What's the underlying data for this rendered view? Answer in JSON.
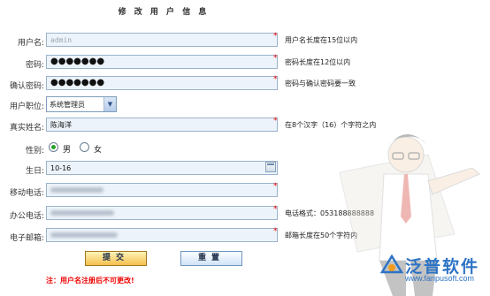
{
  "title": "修 改 用 户 信 息",
  "fields": {
    "username": {
      "label": "用户名:",
      "value": "admin",
      "hint": "用户名长度在15位以内"
    },
    "password": {
      "label": "密码:",
      "value": "●●●●●●●",
      "hint": "密码长度在12位以内"
    },
    "confirm": {
      "label": "确认密码:",
      "value": "●●●●●●●",
      "hint": "密码与确认密码要一致"
    },
    "position": {
      "label": "用户职位:",
      "selected": "系统管理员"
    },
    "realname": {
      "label": "真实姓名:",
      "value": "陈海洋",
      "hint": "在8个汉字（16）个字符之内"
    },
    "gender": {
      "label": "性别:",
      "options": [
        "男",
        "女"
      ],
      "selected": "男"
    },
    "birthday": {
      "label": "生日:",
      "value": "10-16"
    },
    "mobile": {
      "label": "移动电话:"
    },
    "office": {
      "label": "办公电话:",
      "hint": "电话格式：053188888888"
    },
    "email": {
      "label": "电子邮箱:",
      "hint": "邮箱长度在50个字符内"
    }
  },
  "required_mark": "*",
  "buttons": {
    "submit": "提交",
    "reset": "重置"
  },
  "note": "注：用户名注册后不可更改!",
  "logo": {
    "text": "泛普软件",
    "url": "www.fanpusoft.com"
  },
  "colors": {
    "accent": "#2d73c4",
    "required": "#ee0000",
    "field_bg": "#edf3fa",
    "field_border": "#9ab3cc"
  },
  "icons": {
    "calendar": "calendar-icon",
    "dropdown": "chevron-down-icon"
  }
}
